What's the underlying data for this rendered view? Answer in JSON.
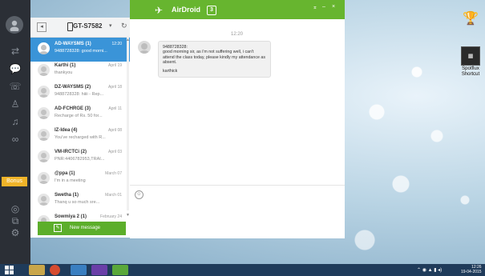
{
  "app": {
    "title": "AirDroid",
    "version_badge": "3",
    "window_controls": {
      "pin": "⌅",
      "minimize": "–",
      "close": "×"
    }
  },
  "nav": {
    "bonus_label": "Bonus",
    "icons": [
      "avatar-icon",
      "file-transfer-icon",
      "message-icon",
      "phone-icon",
      "contacts-icon",
      "notification-icon",
      "binoculars-icon",
      "settings-help-icon",
      "screenshot-icon",
      "gear-icon"
    ]
  },
  "device": {
    "name": "GT-S7582"
  },
  "messages": [
    {
      "name": "AD-WAYSMS (1)",
      "date": "12:20",
      "preview": "9488728328: good morni...",
      "active": true
    },
    {
      "name": "Karthi (1)",
      "date": "April 19",
      "preview": "thankyou",
      "active": false
    },
    {
      "name": "DZ-WAYSMS (2)",
      "date": "April 18",
      "preview": "9488728328: hiiii - Rep...",
      "active": false
    },
    {
      "name": "AD-FCHRGE (3)",
      "date": "April 11",
      "preview": "Recharge of Rs. 50 for...",
      "active": false
    },
    {
      "name": "IZ-Idea (4)",
      "date": "April 08",
      "preview": "You've recharged with R...",
      "active": false
    },
    {
      "name": "VM-IRCTCi (2)",
      "date": "April 03",
      "preview": "PNR:4406782953,TRAI...",
      "active": false
    },
    {
      "name": "@ppa (1)",
      "date": "March 07",
      "preview": "I'm in a meeting",
      "active": false
    },
    {
      "name": "Swetha (1)",
      "date": "March 01",
      "preview": "Thanq u so much sre...",
      "active": false
    },
    {
      "name": "Sowmiya 2 (1)",
      "date": "February 24",
      "preview": "",
      "active": false
    }
  ],
  "new_message_label": "New message",
  "conversation": {
    "time": "12:20",
    "bubble_header": "9488728328:",
    "bubble_body": "good morning sir, as i'm not suffering well, i can't attend the class today, please kindly my attendance as absent.",
    "bubble_signature": "karthick"
  },
  "desktop": {
    "icon_label": "Spotflux Shortcut"
  },
  "taskbar": {
    "time": "12:26",
    "date": "19-04-2015"
  }
}
